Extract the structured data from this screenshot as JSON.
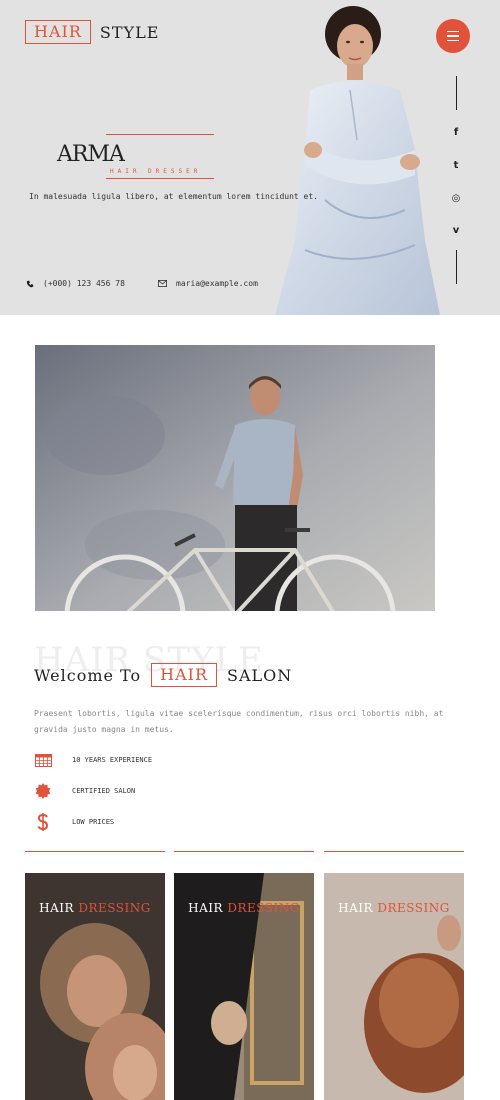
{
  "header": {
    "logo_boxed": "HAIR",
    "logo_plain": "STYLE"
  },
  "hero": {
    "name": "ARMA",
    "subtitle": "HAIR DRESSER",
    "description": "In malesuada ligula libero, at elementum lorem tincidunt et.",
    "phone": "(+000) 123 456 78",
    "email": "maria@example.com"
  },
  "social": {
    "icons": [
      "facebook-icon",
      "twitter-icon",
      "dribbble-icon",
      "vimeo-icon"
    ],
    "labels": [
      "f",
      "t",
      "◎",
      "v"
    ]
  },
  "about": {
    "ghost_title": "HAIR STYLE",
    "welcome_prefix": "Welcome To",
    "welcome_boxed": "HAIR",
    "welcome_suffix": "SALON",
    "description": "Praesent lobortis, ligula vitae scelerisque condimentum, risus orci lobortis nibh, at gravida justo magna in metus.",
    "features": [
      {
        "label": "10 YEARS EXPERIENCE",
        "icon": "calendar-icon"
      },
      {
        "label": "CERTIFIED SALON",
        "icon": "badge-icon"
      },
      {
        "label": "LOW PRICES",
        "icon": "dollar-icon"
      }
    ]
  },
  "cards": [
    {
      "title_white": "HAIR",
      "title_accent": "DRESSING"
    },
    {
      "title_white": "HAIR",
      "title_accent": "DRESSING"
    },
    {
      "title_white": "HAIR",
      "title_accent": "DRESSING"
    }
  ],
  "colors": {
    "accent": "#e0533a",
    "hero_bg": "#e2e2e2",
    "text": "#222222"
  }
}
